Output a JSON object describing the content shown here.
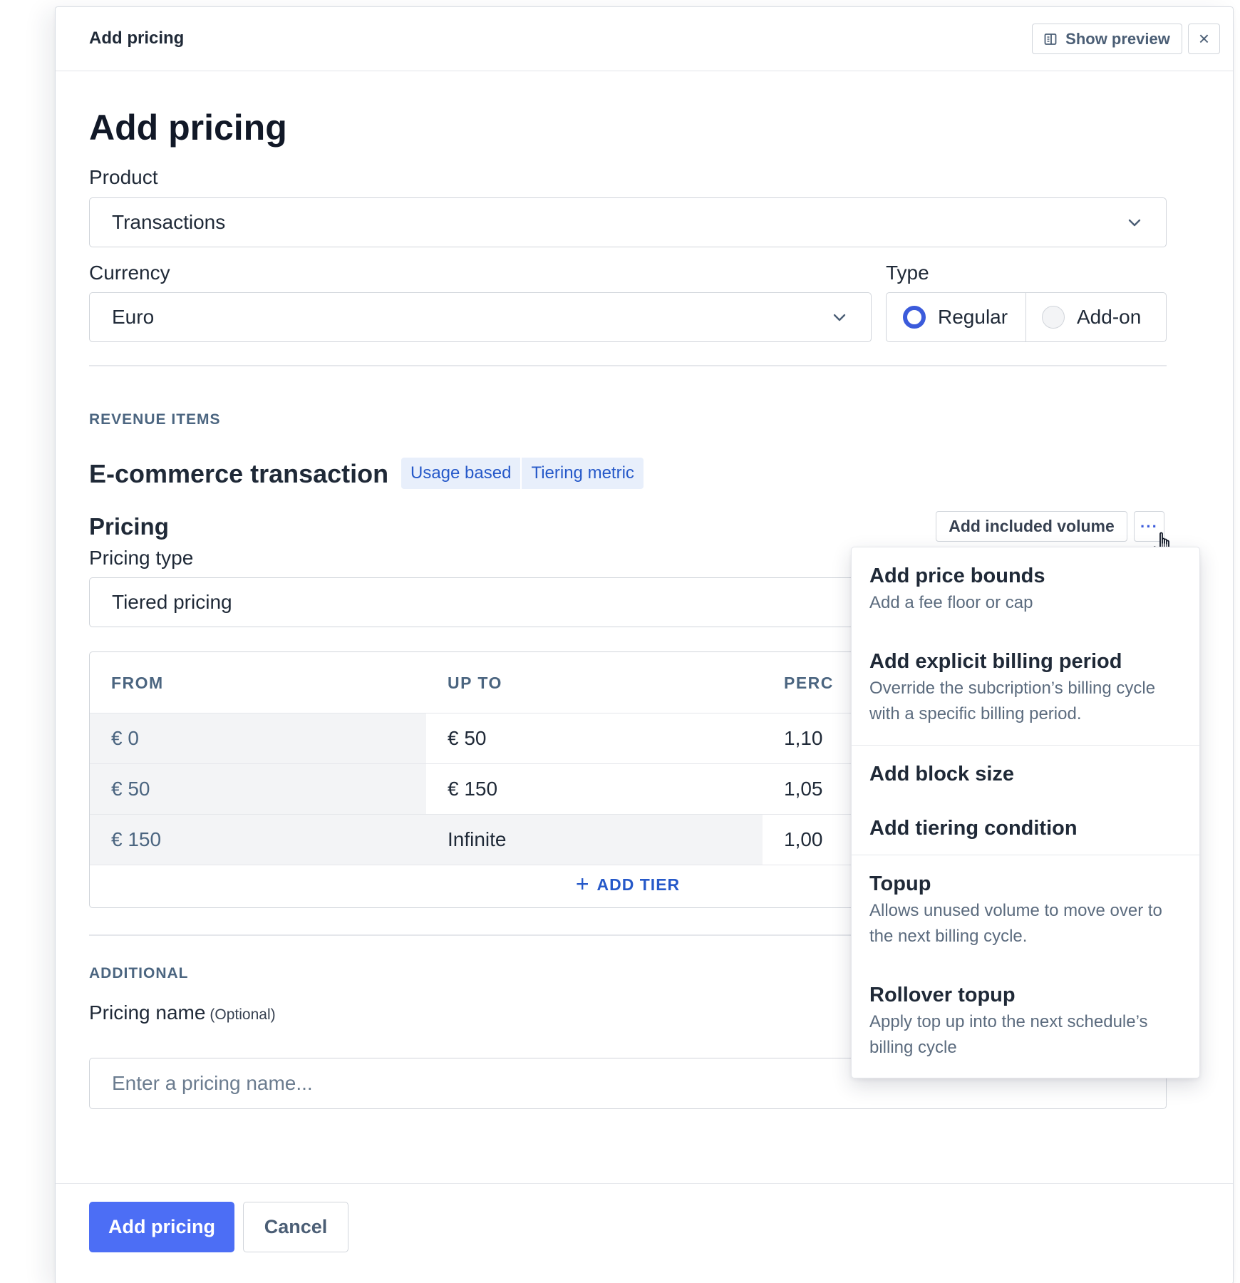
{
  "header": {
    "title": "Add pricing",
    "show_preview_label": "Show preview",
    "close_symbol": "×"
  },
  "page_title": "Add pricing",
  "product": {
    "label": "Product",
    "value": "Transactions"
  },
  "currency": {
    "label": "Currency",
    "value": "Euro"
  },
  "type": {
    "label": "Type",
    "options": [
      {
        "label": "Regular",
        "selected": true
      },
      {
        "label": "Add-on",
        "selected": false
      }
    ]
  },
  "revenue_items": {
    "section_label": "REVENUE ITEMS",
    "item_title": "E-commerce transaction",
    "badges": [
      "Usage based",
      "Tiering metric"
    ]
  },
  "pricing": {
    "title": "Pricing",
    "add_volume_label": "Add included volume",
    "more_label": "···",
    "pricing_type_label": "Pricing type",
    "pricing_type_value": "Tiered pricing",
    "table": {
      "columns": [
        "FROM",
        "UP TO",
        "PERC"
      ],
      "rows": [
        {
          "from": "€ 0",
          "up_to": "€ 50",
          "perc": "1,10"
        },
        {
          "from": "€ 50",
          "up_to": "€ 150",
          "perc": "1,05"
        },
        {
          "from": "€ 150",
          "up_to": "Infinite",
          "perc": "1,00"
        }
      ],
      "add_tier_label": "ADD TIER",
      "add_tier_symbol": "+"
    }
  },
  "additional": {
    "section_label": "ADDITIONAL",
    "pricing_name_label": "Pricing name",
    "optional_label": "(Optional)",
    "pricing_name_placeholder": "Enter a pricing name...",
    "pricing_name_value": ""
  },
  "footer": {
    "submit_label": "Add pricing",
    "cancel_label": "Cancel"
  },
  "menu": {
    "items": [
      {
        "title": "Add price bounds",
        "desc": "Add a fee floor or cap"
      },
      {
        "title": "Add explicit billing period",
        "desc": "Override the subcription’s billing cycle with a specific billing period."
      },
      {
        "title": "Add block size",
        "desc": ""
      },
      {
        "title": "Add tiering condition",
        "desc": ""
      },
      {
        "title": "Topup",
        "desc": "Allows unused volume to move over to the next billing cycle."
      },
      {
        "title": "Rollover topup",
        "desc": "Apply top up into the next schedule’s billing cycle"
      }
    ]
  },
  "colors": {
    "primary": "#4c6ef5",
    "accent_text": "#2659c9",
    "badge_bg": "#e8effb",
    "muted": "#4b6580"
  },
  "icons": [
    "preview-icon",
    "close-icon",
    "chevron-down-icon",
    "more-icon",
    "plus-icon",
    "hand-cursor-icon"
  ]
}
